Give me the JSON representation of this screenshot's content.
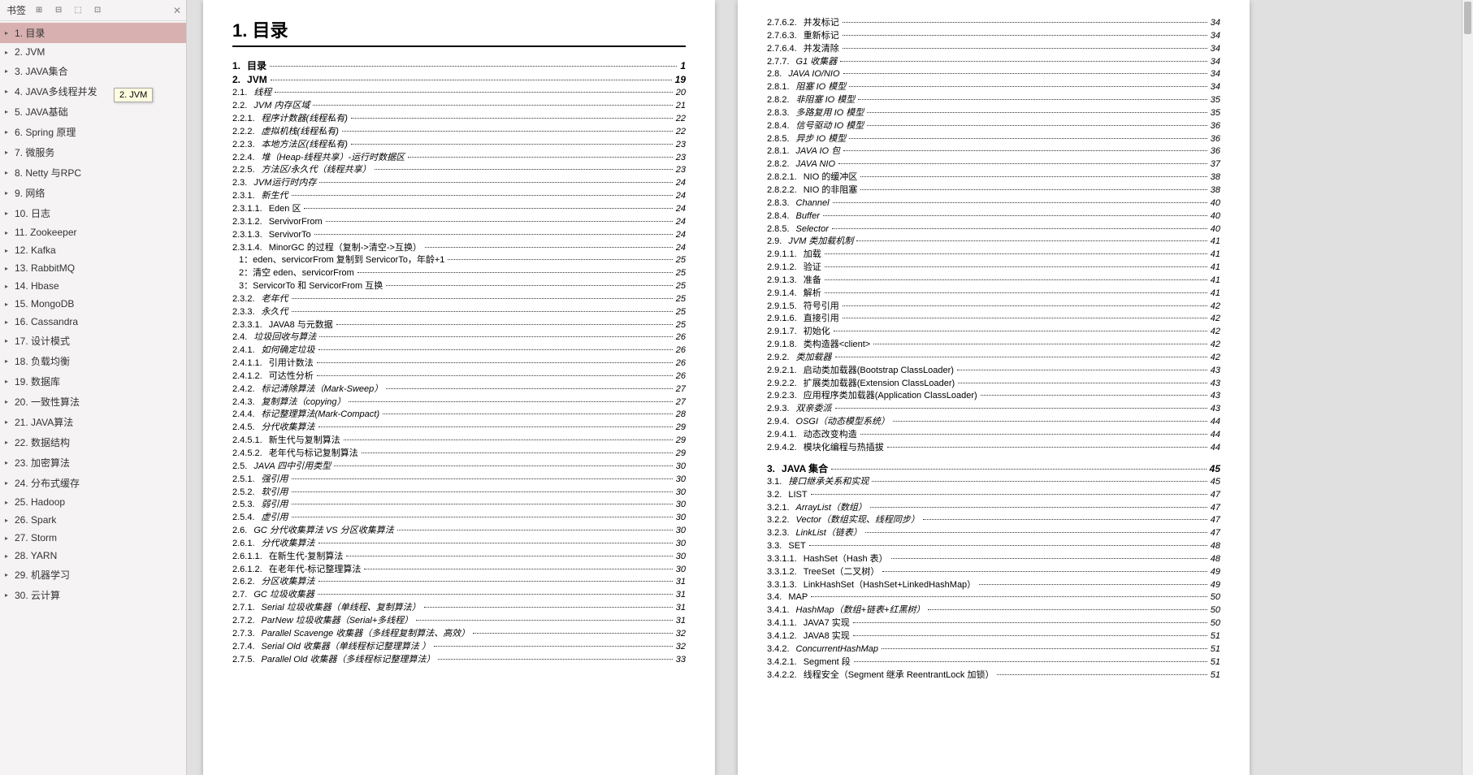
{
  "sidebar": {
    "title": "书签",
    "tooltip": "2. JVM",
    "items": [
      {
        "label": "1. 目录",
        "sel": true
      },
      {
        "label": "2. JVM"
      },
      {
        "label": "3. JAVA集合"
      },
      {
        "label": "4. JAVA多线程并发"
      },
      {
        "label": "5. JAVA基础"
      },
      {
        "label": "6. Spring 原理"
      },
      {
        "label": "7. 微服务"
      },
      {
        "label": "8. Netty 与RPC"
      },
      {
        "label": "9. 网络"
      },
      {
        "label": "10. 日志"
      },
      {
        "label": "11. Zookeeper"
      },
      {
        "label": "12. Kafka"
      },
      {
        "label": "13. RabbitMQ"
      },
      {
        "label": "14. Hbase"
      },
      {
        "label": "15. MongoDB"
      },
      {
        "label": "16. Cassandra"
      },
      {
        "label": "17. 设计模式"
      },
      {
        "label": "18. 负载均衡"
      },
      {
        "label": "19. 数据库"
      },
      {
        "label": "20. 一致性算法"
      },
      {
        "label": "21. JAVA算法"
      },
      {
        "label": "22. 数据结构"
      },
      {
        "label": "23. 加密算法"
      },
      {
        "label": "24. 分布式缓存"
      },
      {
        "label": "25. Hadoop"
      },
      {
        "label": "26. Spark"
      },
      {
        "label": "27. Storm"
      },
      {
        "label": "28. YARN"
      },
      {
        "label": "29. 机器学习"
      },
      {
        "label": "30. 云计算"
      }
    ]
  },
  "page1": {
    "heading": "1. 目录",
    "rows": [
      {
        "lvl": 0,
        "num": "1.",
        "txt": "目录",
        "pg": "1",
        "plain": true,
        "bold": true
      },
      {
        "lvl": 0,
        "num": "2.",
        "txt": "JVM",
        "pg": "19",
        "plain": true,
        "bold": true
      },
      {
        "lvl": 1,
        "num": "2.1.",
        "txt": "线程",
        "pg": "20"
      },
      {
        "lvl": 1,
        "num": "2.2.",
        "txt": "JVM 内存区域",
        "pg": "21"
      },
      {
        "lvl": 2,
        "num": "2.2.1.",
        "txt": "程序计数器(线程私有)",
        "pg": "22"
      },
      {
        "lvl": 2,
        "num": "2.2.2.",
        "txt": "虚拟机栈(线程私有)",
        "pg": "22"
      },
      {
        "lvl": 2,
        "num": "2.2.3.",
        "txt": "本地方法区(线程私有)",
        "pg": "23"
      },
      {
        "lvl": 2,
        "num": "2.2.4.",
        "txt": "堆（Heap-线程共享）-运行时数据区",
        "pg": "23"
      },
      {
        "lvl": 2,
        "num": "2.2.5.",
        "txt": "方法区/永久代（线程共享）",
        "pg": "23"
      },
      {
        "lvl": 1,
        "num": "2.3.",
        "txt": "JVM运行时内存",
        "pg": "24"
      },
      {
        "lvl": 2,
        "num": "2.3.1.",
        "txt": "新生代",
        "pg": "24"
      },
      {
        "lvl": 3,
        "num": "2.3.1.1.",
        "txt": "Eden 区",
        "pg": "24",
        "plain": true
      },
      {
        "lvl": 3,
        "num": "2.3.1.2.",
        "txt": "ServivorFrom",
        "pg": "24",
        "plain": true
      },
      {
        "lvl": 3,
        "num": "2.3.1.3.",
        "txt": "ServivorTo",
        "pg": "24",
        "plain": true
      },
      {
        "lvl": 3,
        "num": "2.3.1.4.",
        "txt": "MinorGC 的过程（复制->清空->互换）",
        "pg": "24",
        "plain": true
      },
      {
        "lvl": 4,
        "num": "",
        "txt": "1：eden、servicorFrom 复制到 ServicorTo，年龄+1",
        "pg": "25",
        "plain": true
      },
      {
        "lvl": 4,
        "num": "",
        "txt": "2：清空 eden、servicorFrom",
        "pg": "25",
        "plain": true
      },
      {
        "lvl": 4,
        "num": "",
        "txt": "3：ServicorTo 和 ServicorFrom 互换",
        "pg": "25",
        "plain": true
      },
      {
        "lvl": 2,
        "num": "2.3.2.",
        "txt": "老年代",
        "pg": "25"
      },
      {
        "lvl": 2,
        "num": "2.3.3.",
        "txt": "永久代",
        "pg": "25"
      },
      {
        "lvl": 3,
        "num": "2.3.3.1.",
        "txt": "JAVA8 与元数据",
        "pg": "25",
        "plain": true
      },
      {
        "lvl": 1,
        "num": "2.4.",
        "txt": "垃圾回收与算法",
        "pg": "26"
      },
      {
        "lvl": 2,
        "num": "2.4.1.",
        "txt": "如何确定垃圾",
        "pg": "26"
      },
      {
        "lvl": 3,
        "num": "2.4.1.1.",
        "txt": "引用计数法",
        "pg": "26",
        "plain": true
      },
      {
        "lvl": 3,
        "num": "2.4.1.2.",
        "txt": "可达性分析",
        "pg": "26",
        "plain": true
      },
      {
        "lvl": 2,
        "num": "2.4.2.",
        "txt": "标记清除算法（Mark-Sweep）",
        "pg": "27"
      },
      {
        "lvl": 2,
        "num": "2.4.3.",
        "txt": "复制算法（copying）",
        "pg": "27"
      },
      {
        "lvl": 2,
        "num": "2.4.4.",
        "txt": "标记整理算法(Mark-Compact)",
        "pg": "28"
      },
      {
        "lvl": 2,
        "num": "2.4.5.",
        "txt": "分代收集算法",
        "pg": "29"
      },
      {
        "lvl": 3,
        "num": "2.4.5.1.",
        "txt": "新生代与复制算法",
        "pg": "29",
        "plain": true
      },
      {
        "lvl": 3,
        "num": "2.4.5.2.",
        "txt": "老年代与标记复制算法",
        "pg": "29",
        "plain": true
      },
      {
        "lvl": 1,
        "num": "2.5.",
        "txt": "JAVA 四中引用类型",
        "pg": "30"
      },
      {
        "lvl": 2,
        "num": "2.5.1.",
        "txt": "强引用",
        "pg": "30"
      },
      {
        "lvl": 2,
        "num": "2.5.2.",
        "txt": "软引用",
        "pg": "30"
      },
      {
        "lvl": 2,
        "num": "2.5.3.",
        "txt": "弱引用",
        "pg": "30"
      },
      {
        "lvl": 2,
        "num": "2.5.4.",
        "txt": "虚引用",
        "pg": "30"
      },
      {
        "lvl": 1,
        "num": "2.6.",
        "txt": "GC 分代收集算法 VS 分区收集算法",
        "pg": "30"
      },
      {
        "lvl": 2,
        "num": "2.6.1.",
        "txt": "分代收集算法",
        "pg": "30"
      },
      {
        "lvl": 3,
        "num": "2.6.1.1.",
        "txt": "在新生代-复制算法",
        "pg": "30",
        "plain": true
      },
      {
        "lvl": 3,
        "num": "2.6.1.2.",
        "txt": "在老年代-标记整理算法",
        "pg": "30",
        "plain": true
      },
      {
        "lvl": 2,
        "num": "2.6.2.",
        "txt": "分区收集算法",
        "pg": "31"
      },
      {
        "lvl": 1,
        "num": "2.7.",
        "txt": "GC 垃圾收集器",
        "pg": "31"
      },
      {
        "lvl": 2,
        "num": "2.7.1.",
        "txt": "Serial 垃圾收集器（单线程、复制算法）",
        "pg": "31"
      },
      {
        "lvl": 2,
        "num": "2.7.2.",
        "txt": "ParNew 垃圾收集器（Serial+多线程）",
        "pg": "31"
      },
      {
        "lvl": 2,
        "num": "2.7.3.",
        "txt": "Parallel Scavenge 收集器（多线程复制算法、高效）",
        "pg": "32"
      },
      {
        "lvl": 2,
        "num": "2.7.4.",
        "txt": "Serial Old 收集器（单线程标记整理算法 ）",
        "pg": "32"
      },
      {
        "lvl": 2,
        "num": "2.7.5.",
        "txt": "Parallel Old 收集器（多线程标记整理算法）",
        "pg": "33"
      }
    ]
  },
  "page2": {
    "rows": [
      {
        "lvl": 3,
        "num": "2.7.6.2.",
        "txt": "并发标记",
        "pg": "34",
        "plain": true
      },
      {
        "lvl": 3,
        "num": "2.7.6.3.",
        "txt": "重新标记",
        "pg": "34",
        "plain": true
      },
      {
        "lvl": 3,
        "num": "2.7.6.4.",
        "txt": "并发清除",
        "pg": "34",
        "plain": true
      },
      {
        "lvl": 2,
        "num": "2.7.7.",
        "txt": "G1 收集器",
        "pg": "34"
      },
      {
        "lvl": 1,
        "num": "2.8.",
        "txt": "JAVA IO/NIO",
        "pg": "34"
      },
      {
        "lvl": 2,
        "num": "2.8.1.",
        "txt": "阻塞 IO 模型",
        "pg": "34"
      },
      {
        "lvl": 2,
        "num": "2.8.2.",
        "txt": "非阻塞 IO 模型",
        "pg": "35"
      },
      {
        "lvl": 2,
        "num": "2.8.3.",
        "txt": "多路复用 IO 模型",
        "pg": "35"
      },
      {
        "lvl": 2,
        "num": "2.8.4.",
        "txt": "信号驱动 IO 模型",
        "pg": "36"
      },
      {
        "lvl": 2,
        "num": "2.8.5.",
        "txt": "异步 IO 模型",
        "pg": "36"
      },
      {
        "lvl": 2,
        "num": "2.8.1.",
        "txt": "JAVA IO 包",
        "pg": "36"
      },
      {
        "lvl": 2,
        "num": "2.8.2.",
        "txt": "JAVA NIO",
        "pg": "37"
      },
      {
        "lvl": 3,
        "num": "2.8.2.1.",
        "txt": "NIO 的缓冲区",
        "pg": "38",
        "plain": true
      },
      {
        "lvl": 3,
        "num": "2.8.2.2.",
        "txt": "NIO 的非阻塞",
        "pg": "38",
        "plain": true
      },
      {
        "lvl": 2,
        "num": "2.8.3.",
        "txt": "Channel",
        "pg": "40"
      },
      {
        "lvl": 2,
        "num": "2.8.4.",
        "txt": "Buffer",
        "pg": "40"
      },
      {
        "lvl": 2,
        "num": "2.8.5.",
        "txt": "Selector",
        "pg": "40"
      },
      {
        "lvl": 1,
        "num": "2.9.",
        "txt": "JVM 类加载机制",
        "pg": "41"
      },
      {
        "lvl": 3,
        "num": "2.9.1.1.",
        "txt": "加载",
        "pg": "41",
        "plain": true
      },
      {
        "lvl": 3,
        "num": "2.9.1.2.",
        "txt": "验证",
        "pg": "41",
        "plain": true
      },
      {
        "lvl": 3,
        "num": "2.9.1.3.",
        "txt": "准备",
        "pg": "41",
        "plain": true
      },
      {
        "lvl": 3,
        "num": "2.9.1.4.",
        "txt": "解析",
        "pg": "41",
        "plain": true
      },
      {
        "lvl": 3,
        "num": "2.9.1.5.",
        "txt": "符号引用",
        "pg": "42",
        "plain": true
      },
      {
        "lvl": 3,
        "num": "2.9.1.6.",
        "txt": "直接引用",
        "pg": "42",
        "plain": true
      },
      {
        "lvl": 3,
        "num": "2.9.1.7.",
        "txt": "初始化",
        "pg": "42",
        "plain": true
      },
      {
        "lvl": 3,
        "num": "2.9.1.8.",
        "txt": "类构造器<client>",
        "pg": "42",
        "plain": true
      },
      {
        "lvl": 2,
        "num": "2.9.2.",
        "txt": "类加载器",
        "pg": "42"
      },
      {
        "lvl": 3,
        "num": "2.9.2.1.",
        "txt": "启动类加载器(Bootstrap ClassLoader)",
        "pg": "43",
        "plain": true
      },
      {
        "lvl": 3,
        "num": "2.9.2.2.",
        "txt": "扩展类加载器(Extension ClassLoader)",
        "pg": "43",
        "plain": true
      },
      {
        "lvl": 3,
        "num": "2.9.2.3.",
        "txt": "应用程序类加载器(Application ClassLoader)",
        "pg": "43",
        "plain": true
      },
      {
        "lvl": 2,
        "num": "2.9.3.",
        "txt": "双亲委派",
        "pg": "43"
      },
      {
        "lvl": 2,
        "num": "2.9.4.",
        "txt": "OSGI（动态模型系统）",
        "pg": "44"
      },
      {
        "lvl": 3,
        "num": "2.9.4.1.",
        "txt": "动态改变构造",
        "pg": "44",
        "plain": true
      },
      {
        "lvl": 3,
        "num": "2.9.4.2.",
        "txt": "模块化编程与热插拔",
        "pg": "44",
        "plain": true
      },
      {
        "lvl": 0,
        "num": "3.",
        "txt": "JAVA 集合",
        "pg": "45",
        "plain": true,
        "bold": true,
        "mt": true
      },
      {
        "lvl": 1,
        "num": "3.1.",
        "txt": "接口继承关系和实现",
        "pg": "45"
      },
      {
        "lvl": 1,
        "num": "3.2.",
        "txt": "LIST",
        "pg": "47",
        "plain": true
      },
      {
        "lvl": 2,
        "num": "3.2.1.",
        "txt": "ArrayList（数组）",
        "pg": "47"
      },
      {
        "lvl": 2,
        "num": "3.2.2.",
        "txt": "Vector（数组实现、线程同步）",
        "pg": "47"
      },
      {
        "lvl": 2,
        "num": "3.2.3.",
        "txt": "LinkList（链表）",
        "pg": "47"
      },
      {
        "lvl": 1,
        "num": "3.3.",
        "txt": "SET",
        "pg": "48",
        "plain": true
      },
      {
        "lvl": 3,
        "num": "3.3.1.1.",
        "txt": "HashSet（Hash 表）",
        "pg": "48",
        "plain": true
      },
      {
        "lvl": 3,
        "num": "3.3.1.2.",
        "txt": "TreeSet（二叉树）",
        "pg": "49",
        "plain": true
      },
      {
        "lvl": 3,
        "num": "3.3.1.3.",
        "txt": "LinkHashSet（HashSet+LinkedHashMap）",
        "pg": "49",
        "plain": true
      },
      {
        "lvl": 1,
        "num": "3.4.",
        "txt": "MAP",
        "pg": "50",
        "plain": true
      },
      {
        "lvl": 2,
        "num": "3.4.1.",
        "txt": "HashMap（数组+链表+红黑树）",
        "pg": "50"
      },
      {
        "lvl": 3,
        "num": "3.4.1.1.",
        "txt": "JAVA7 实现",
        "pg": "50",
        "plain": true
      },
      {
        "lvl": 3,
        "num": "3.4.1.2.",
        "txt": "JAVA8 实现",
        "pg": "51",
        "plain": true
      },
      {
        "lvl": 2,
        "num": "3.4.2.",
        "txt": "ConcurrentHashMap",
        "pg": "51"
      },
      {
        "lvl": 3,
        "num": "3.4.2.1.",
        "txt": "Segment 段",
        "pg": "51",
        "plain": true
      },
      {
        "lvl": 3,
        "num": "3.4.2.2.",
        "txt": "线程安全（Segment 继承 ReentrantLock 加锁）",
        "pg": "51",
        "plain": true
      }
    ]
  }
}
